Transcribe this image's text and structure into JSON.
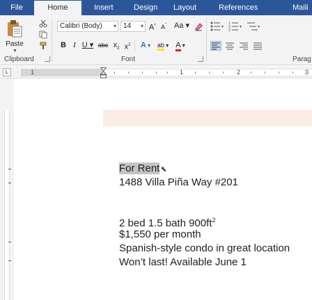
{
  "ribbon_tabs": {
    "file": "File",
    "home": "Home",
    "insert": "Insert",
    "design": "Design",
    "layout": "Layout",
    "references": "References",
    "mailings": "Maili"
  },
  "clipboard": {
    "paste_label": "Paste",
    "group_label": "Clipboard"
  },
  "font": {
    "font_name": "Calibri (Body)",
    "font_size": "14",
    "grow_label": "A",
    "shrink_label": "A",
    "case_label": "Aa",
    "bold": "B",
    "italic": "I",
    "underline": "U",
    "strikethrough": "abc",
    "subscript": "x",
    "superscript": "x",
    "effects": "A",
    "highlight": "ab",
    "font_color": "A",
    "group_label": "Font"
  },
  "paragraph": {
    "group_label": "Parag"
  },
  "ruler": {
    "tab_selector": "L",
    "numbers": [
      "1",
      "1",
      "2",
      "3"
    ]
  },
  "document": {
    "lines": [
      "For Rent",
      "1488 Villa Piña Way #201",
      "",
      "2 bed 1.5 bath 900ft",
      "$1,550 per month",
      "Spanish-style condo in great location",
      "Won’t last! Available June 1"
    ],
    "superscript": "2"
  },
  "colors": {
    "ribbon_blue": "#2b579a",
    "ribbon_body": "#f3f3f3",
    "selection": "#c4c4c4"
  }
}
